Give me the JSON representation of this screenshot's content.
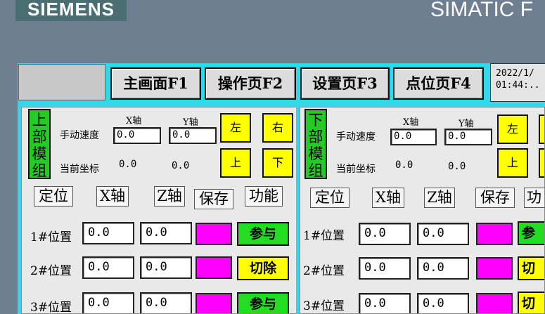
{
  "header": {
    "brand": "SIEMENS",
    "product": "SIMATIC F"
  },
  "nav": {
    "buttons": [
      "主画面F1",
      "操作页F2",
      "设置页F3",
      "点位页F4"
    ],
    "datetime": "2022/1/\n01:44:.."
  },
  "colors": {
    "background": "#6d7f90",
    "cyan": "#32d8ea",
    "green": "#22dd22",
    "yellow": "#ffff00",
    "magenta": "#ff00ff"
  },
  "panels": [
    {
      "module": "上部模组",
      "manual_speed_label": "手动速度",
      "x_axis_label": "X轴",
      "y_axis_label": "Y轴",
      "speed_x": "0.0",
      "speed_y": "0.0",
      "coord_label": "当前坐标",
      "coord_x": "0.0",
      "coord_y": "0.0",
      "btn_left": "左",
      "btn_right": "右",
      "btn_up": "上",
      "btn_down": "下",
      "headers": [
        "定位",
        "X轴",
        "Z轴",
        "保存",
        "功能"
      ],
      "rows": [
        {
          "label": "1#位置",
          "x": "0.0",
          "z": "0.0",
          "action": "参与"
        },
        {
          "label": "2#位置",
          "x": "0.0",
          "z": "0.0",
          "action": "切除"
        },
        {
          "label": "3#位置",
          "x": "0.0",
          "z": "0.0",
          "action": "参与"
        }
      ]
    },
    {
      "module": "下部模组",
      "manual_speed_label": "手动速度",
      "x_axis_label": "X轴",
      "y_axis_label": "Y轴",
      "speed_x": "0.0",
      "speed_y": "0.0",
      "coord_label": "当前坐标",
      "coord_x": "0.0",
      "coord_y": "0.0",
      "btn_left": "左",
      "btn_up": "上",
      "headers": [
        "定位",
        "X轴",
        "Z轴",
        "保存",
        "功"
      ],
      "rows": [
        {
          "label": "1#位置",
          "x": "0.0",
          "z": "0.0",
          "action": "参"
        },
        {
          "label": "2#位置",
          "x": "0.0",
          "z": "0.0",
          "action": "切"
        },
        {
          "label": "3#位置",
          "x": "0.0",
          "z": "0.0",
          "action": "切"
        }
      ]
    }
  ]
}
